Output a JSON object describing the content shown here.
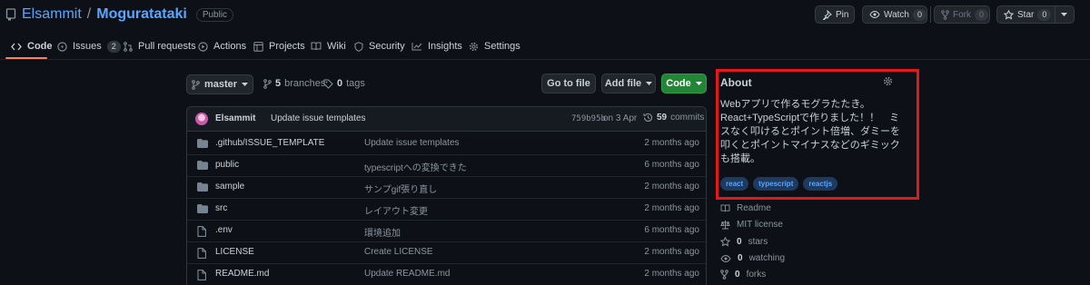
{
  "repo": {
    "owner": "Elsammit",
    "separator": "/",
    "name": "Moguratataki",
    "visibility": "Public"
  },
  "header_actions": {
    "pin": "Pin",
    "watch": {
      "label": "Watch",
      "count": "0"
    },
    "fork": {
      "label": "Fork",
      "count": "0"
    },
    "star": {
      "label": "Star",
      "count": "0"
    }
  },
  "nav": {
    "code": "Code",
    "issues": {
      "label": "Issues",
      "count": "2"
    },
    "pull_requests": "Pull requests",
    "actions": "Actions",
    "projects": "Projects",
    "wiki": "Wiki",
    "security": "Security",
    "insights": "Insights",
    "settings": "Settings"
  },
  "branch_bar": {
    "branch": "master",
    "branches": {
      "count": "5",
      "label": "branches"
    },
    "tags": {
      "count": "0",
      "label": "tags"
    },
    "go_to_file": "Go to file",
    "add_file": "Add file",
    "code": "Code"
  },
  "latest_commit": {
    "author": "Elsammit",
    "message": "Update issue templates",
    "sha": "759b95b",
    "date": "on 3 Apr",
    "commits": {
      "count": "59",
      "label": "commits"
    }
  },
  "files": [
    {
      "type": "dir",
      "name": ".github/ISSUE_TEMPLATE",
      "message": "Update issue templates",
      "time": "2 months ago"
    },
    {
      "type": "dir",
      "name": "public",
      "message": "typescriptへの変換できた",
      "time": "6 months ago"
    },
    {
      "type": "dir",
      "name": "sample",
      "message": "サンプgif張り直し",
      "time": "2 months ago"
    },
    {
      "type": "dir",
      "name": "src",
      "message": "レイアウト変更",
      "time": "2 months ago"
    },
    {
      "type": "file",
      "name": ".env",
      "message": "環境追加",
      "time": "6 months ago"
    },
    {
      "type": "file",
      "name": "LICENSE",
      "message": "Create LICENSE",
      "time": "2 months ago"
    },
    {
      "type": "file",
      "name": "README.md",
      "message": "Update README.md",
      "time": "2 months ago"
    }
  ],
  "about": {
    "title": "About",
    "description_lines": [
      "Webアプリで作るモグラたたき。",
      "React+TypeScriptで作りました！！　ミ",
      "スなく叩けるとポイント倍増、ダミーを",
      "叩くとポイントマイナスなどのギミック",
      "も搭載。"
    ],
    "topics": [
      "react",
      "typescript",
      "reactjs"
    ]
  },
  "sidebar": {
    "readme": "Readme",
    "license": "MIT license",
    "stars": {
      "count": "0",
      "label": "stars"
    },
    "watching": {
      "count": "0",
      "label": "watching"
    },
    "forks": {
      "count": "0",
      "label": "forks"
    }
  },
  "colors": {
    "background": "#0d1117",
    "accent_link": "#58a6ff",
    "green_button": "#238636",
    "highlight_box": "#e1191b",
    "nav_underline": "#f78166"
  }
}
